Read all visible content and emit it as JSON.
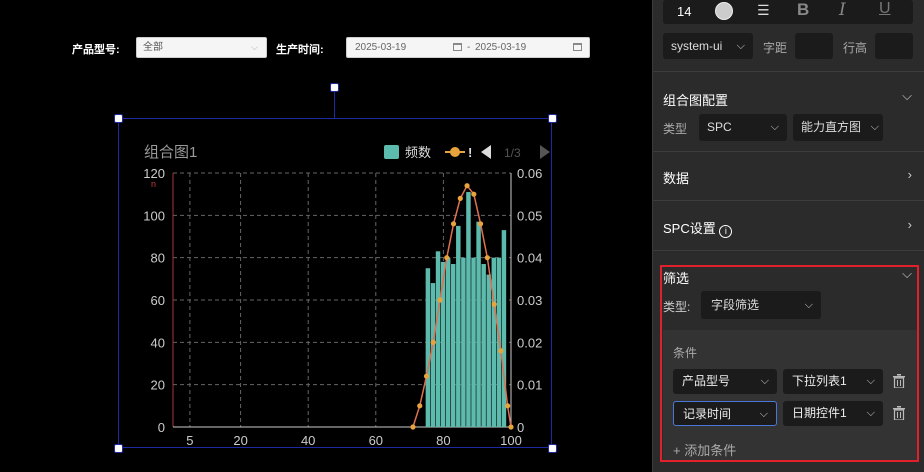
{
  "filters": {
    "product_label": "产品型号:",
    "product_value": "全部",
    "time_label": "生产时间:",
    "date_start": "2025-03-19",
    "date_sep": "-",
    "date_end": "2025-03-19"
  },
  "chart_data": {
    "type": "bar",
    "title": "组合图1",
    "legend": {
      "placement": "top-right",
      "series_name": "频数",
      "page": "1/3"
    },
    "left_unit": "n",
    "x_ticks": [
      5,
      20,
      40,
      60,
      80,
      100
    ],
    "xlim": [
      0,
      100
    ],
    "y_left_ticks": [
      0,
      20,
      40,
      60,
      80,
      100,
      120
    ],
    "ylim_left": [
      0,
      120
    ],
    "y_right_ticks": [
      0,
      0.01,
      0.02,
      0.03,
      0.04,
      0.05,
      0.06
    ],
    "ylim_right": [
      0,
      0.06
    ],
    "grid": true,
    "bars": {
      "name": "频数",
      "x": [
        75.5,
        77,
        78.5,
        80,
        81.5,
        83,
        84.5,
        86,
        87.5,
        89,
        90.5,
        92,
        93.5,
        95,
        96.5,
        98
      ],
      "values": [
        75,
        68,
        83,
        78,
        80,
        77,
        95,
        80,
        111,
        80,
        97,
        77,
        72,
        80,
        80,
        93
      ]
    },
    "curve": {
      "x": [
        71,
        73,
        75,
        77,
        79,
        81,
        83,
        85,
        87,
        89,
        91,
        93,
        95,
        97,
        99,
        100
      ],
      "values": [
        0,
        0.005,
        0.012,
        0.02,
        0.03,
        0.04,
        0.048,
        0.054,
        0.057,
        0.055,
        0.048,
        0.04,
        0.029,
        0.018,
        0.005,
        0
      ]
    },
    "colors": {
      "bar": "#5dbbae",
      "curve": "#e8a33c",
      "curve_line": "#e07050",
      "axis": "#cccccc",
      "grid": "#666666"
    }
  },
  "panel": {
    "font_size": "14",
    "font_family": "system-ui",
    "letter_spacing_label": "字距",
    "line_height_label": "行高",
    "combo_title": "组合图配置",
    "type_label": "类型",
    "type_value": "SPC",
    "subtype_value": "能力直方图",
    "data_title": "数据",
    "spc_title": "SPC设置",
    "filter_title": "筛选",
    "filter_type_label": "类型:",
    "filter_type_value": "字段筛选",
    "conditions_label": "条件",
    "conditions": [
      {
        "field": "产品型号",
        "control": "下拉列表1"
      },
      {
        "field": "记录时间",
        "control": "日期控件1"
      }
    ],
    "add_condition": "添加条件"
  }
}
